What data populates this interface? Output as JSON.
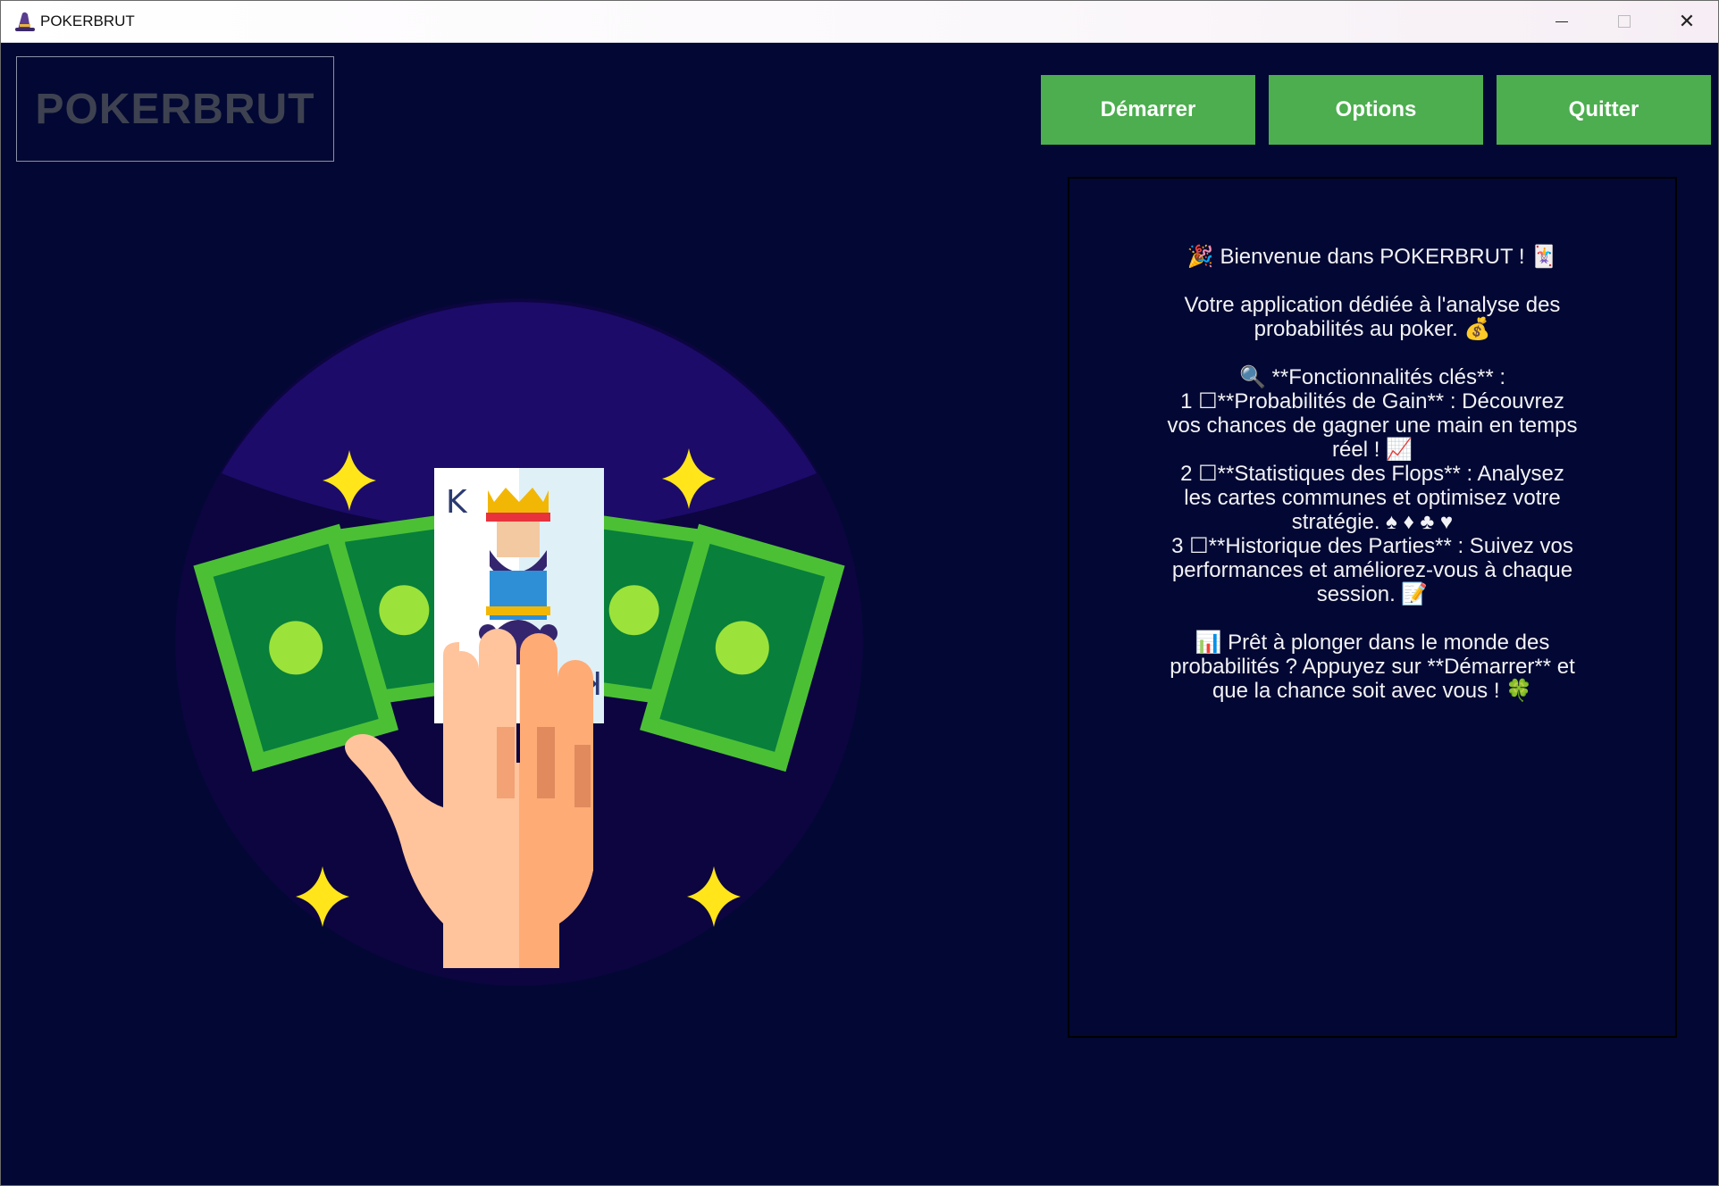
{
  "window": {
    "title": "POKERBRUT",
    "app_icon": "wizard-hat-icon"
  },
  "controls": {
    "minimize": "─",
    "maximize": "☐",
    "close": "✕"
  },
  "header": {
    "logo": "POKERBRUT"
  },
  "buttons": {
    "start": "Démarrer",
    "options": "Options",
    "quit": "Quitter"
  },
  "colors": {
    "background": "#020833",
    "button": "#4cae4f",
    "logo_text": "#3e4150"
  },
  "panel": {
    "welcome": "🎉 Bienvenue dans POKERBRUT ! 🃏",
    "intro": "Votre application dédiée à l'analyse des probabilités au poker. 💰",
    "features_title": "🔍 **Fonctionnalités clés** :",
    "f1": "1 ☐**Probabilités de Gain** : Découvrez vos chances de gagner une main en temps réel ! 📈",
    "f2": "2 ☐**Statistiques des Flops** : Analysez les cartes communes et optimisez votre stratégie. ♠ ♦ ♣ ♥",
    "f3": "3 ☐**Historique des Parties** : Suivez vos performances et améliorez-vous à chaque session. 📝",
    "outro": "📊 Prêt à plonger dans le monde des probabilités ? Appuyez sur **Démarrer** et que la chance soit avec vous ! 🍀"
  },
  "illustration": {
    "card_rank": "K",
    "subject": "hand-holding-king-card-and-banknotes"
  }
}
